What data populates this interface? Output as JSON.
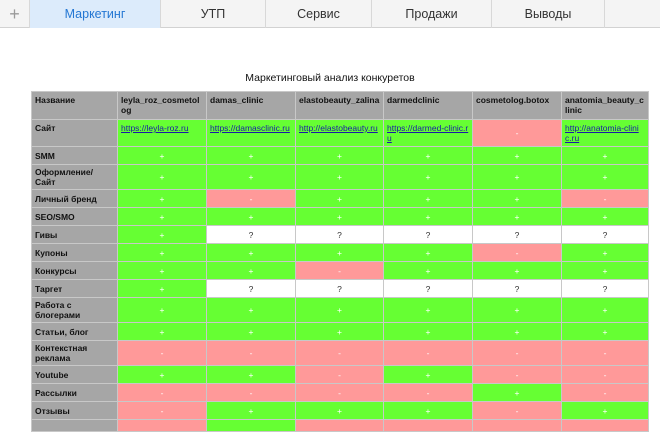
{
  "tabs": [
    "Маркетинг",
    "УТП",
    "Сервис",
    "Продажи",
    "Выводы"
  ],
  "add_tab": "+",
  "sheet_title": "Маркетинговый анализ конкуретов",
  "table": {
    "header": [
      "Название",
      "leyla_roz_cosmetolog",
      "damas_clinic",
      "elastobeauty_zalina",
      "darmedclinic",
      "cosmetolog.botox",
      "anatomia_beauty_clinic"
    ],
    "site_row": {
      "label": "Сайт",
      "cells": [
        {
          "text": "https://leyla-roz.ru",
          "color": "g",
          "link": true
        },
        {
          "text": "https://damasclinic.ru",
          "color": "g",
          "link": true
        },
        {
          "text": "http://elastobeauty.ru",
          "color": "g",
          "link": true
        },
        {
          "text": "https://darmed-clinic.ru",
          "color": "g",
          "link": true
        },
        {
          "text": "-",
          "color": "r",
          "link": false
        },
        {
          "text": "http://anatomia-clinic.ru",
          "color": "g",
          "link": true
        }
      ]
    },
    "rows": [
      {
        "label": "SMM",
        "cells": [
          "+",
          "+",
          "+",
          "+",
          "+",
          "+"
        ],
        "colors": [
          "g",
          "g",
          "g",
          "g",
          "g",
          "g"
        ]
      },
      {
        "label": "Оформление/ Сайт",
        "cells": [
          "+",
          "+",
          "+",
          "+",
          "+",
          "+"
        ],
        "colors": [
          "g",
          "g",
          "g",
          "g",
          "g",
          "g"
        ]
      },
      {
        "label": "Личный бренд",
        "cells": [
          "+",
          "-",
          "+",
          "+",
          "+",
          "-"
        ],
        "colors": [
          "g",
          "r",
          "g",
          "g",
          "g",
          "r"
        ]
      },
      {
        "label": "SEO/SMO",
        "cells": [
          "+",
          "+",
          "+",
          "+",
          "+",
          "+"
        ],
        "colors": [
          "g",
          "g",
          "g",
          "g",
          "g",
          "g"
        ]
      },
      {
        "label": "Гивы",
        "cells": [
          "+",
          "?",
          "?",
          "?",
          "?",
          "?"
        ],
        "colors": [
          "g",
          "w",
          "w",
          "w",
          "w",
          "w"
        ]
      },
      {
        "label": "Купоны",
        "cells": [
          "+",
          "+",
          "+",
          "+",
          "-",
          "+"
        ],
        "colors": [
          "g",
          "g",
          "g",
          "g",
          "r",
          "g"
        ]
      },
      {
        "label": "Конкурсы",
        "cells": [
          "+",
          "+",
          "-",
          "+",
          "+",
          "+"
        ],
        "colors": [
          "g",
          "g",
          "r",
          "g",
          "g",
          "g"
        ]
      },
      {
        "label": "Таргет",
        "cells": [
          "+",
          "?",
          "?",
          "?",
          "?",
          "?"
        ],
        "colors": [
          "g",
          "w",
          "w",
          "w",
          "w",
          "w"
        ]
      },
      {
        "label": "Работа с блогерами",
        "cells": [
          "+",
          "+",
          "+",
          "+",
          "+",
          "+"
        ],
        "colors": [
          "g",
          "g",
          "g",
          "g",
          "g",
          "g"
        ]
      },
      {
        "label": "Статьи, блог",
        "cells": [
          "+",
          "+",
          "+",
          "+",
          "+",
          "+"
        ],
        "colors": [
          "g",
          "g",
          "g",
          "g",
          "g",
          "g"
        ]
      },
      {
        "label": "Контекстная реклама",
        "cells": [
          "-",
          "-",
          "-",
          "-",
          "-",
          "-"
        ],
        "colors": [
          "r",
          "r",
          "r",
          "r",
          "r",
          "r"
        ]
      },
      {
        "label": "Youtube",
        "cells": [
          "+",
          "+",
          "-",
          "+",
          "-",
          "-"
        ],
        "colors": [
          "g",
          "g",
          "r",
          "g",
          "r",
          "r"
        ]
      },
      {
        "label": "Рассылки",
        "cells": [
          "-",
          "-",
          "-",
          "-",
          "+",
          "-"
        ],
        "colors": [
          "r",
          "r",
          "r",
          "r",
          "g",
          "r"
        ]
      },
      {
        "label": "Отзывы",
        "cells": [
          "-",
          "+",
          "+",
          "+",
          "-",
          "+"
        ],
        "colors": [
          "r",
          "g",
          "g",
          "g",
          "r",
          "g"
        ]
      },
      {
        "label": "",
        "cells": [
          "",
          "",
          "",
          "",
          "",
          ""
        ],
        "colors": [
          "r",
          "g",
          "r",
          "r",
          "r",
          "r"
        ]
      }
    ]
  },
  "colors": {
    "green": "#66ff33",
    "red": "#ff9999",
    "header_gray": "#a6a6a6",
    "active_tab": "#dcebfb"
  }
}
